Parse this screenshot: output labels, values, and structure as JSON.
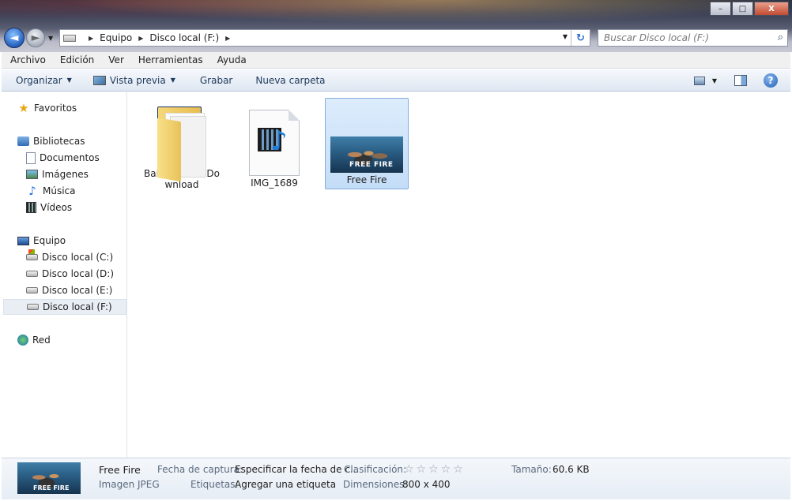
{
  "window": {
    "minimize_label": "–",
    "maximize_label": "□",
    "close_label": "X"
  },
  "address": {
    "segments": [
      "Equipo",
      "Disco local (F:)"
    ]
  },
  "search": {
    "placeholder": "Buscar Disco local (F:)"
  },
  "menu": [
    "Archivo",
    "Edición",
    "Ver",
    "Herramientas",
    "Ayuda"
  ],
  "toolbar": {
    "organize": "Organizar",
    "preview": "Vista previa",
    "burn": "Grabar",
    "new_folder": "Nueva carpeta"
  },
  "sidebar": {
    "favorites": "Favoritos",
    "libraries": "Bibliotecas",
    "documents": "Documentos",
    "images": "Imágenes",
    "music": "Música",
    "videos": "Vídeos",
    "computer": "Equipo",
    "drive_c": "Disco local (C:)",
    "drive_d": "Disco local (D:)",
    "drive_e": "Disco local (E:)",
    "drive_f": "Disco local (F:)",
    "network": "Red"
  },
  "files": [
    {
      "name": "BaiduNetdiskDownload",
      "type": "folder"
    },
    {
      "name": "IMG_1689",
      "type": "video"
    },
    {
      "name": "Free Fire",
      "type": "image",
      "thumb_text": "FREE FIRE"
    }
  ],
  "details": {
    "name": "Free Fire",
    "type": "Imagen JPEG",
    "thumb_text": "FREE FIRE",
    "capture_label": "Fecha de captura:",
    "capture_value": "Especificar la fecha de c...",
    "tags_label": "Etiquetas:",
    "tags_value": "Agregar una etiqueta",
    "rating_label": "Clasificación:",
    "rating_stars": "☆☆☆☆☆",
    "rating_value": 0,
    "dimensions_label": "Dimensiones:",
    "dimensions_value": "800 x 400",
    "size_label": "Tamaño:",
    "size_value": "60.6 KB"
  }
}
